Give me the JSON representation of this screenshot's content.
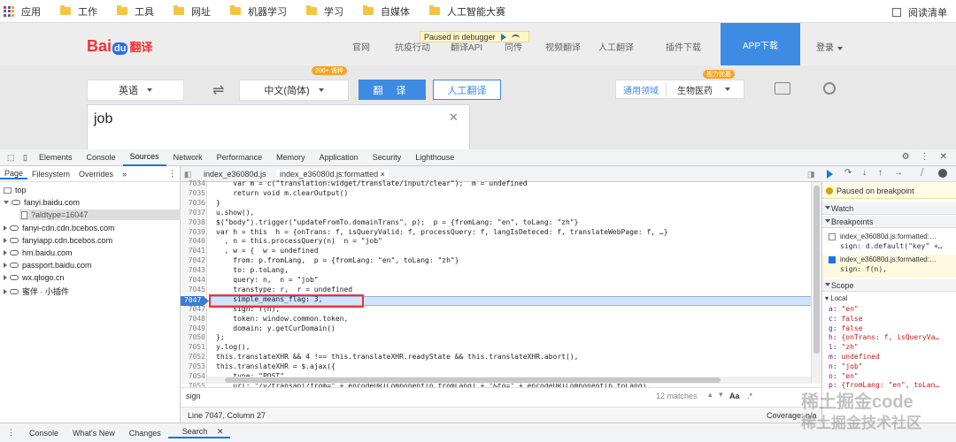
{
  "bookmarks": {
    "items": [
      "应用",
      "工作",
      "工具",
      "网址",
      "机器学习",
      "学习",
      "自媒体",
      "人工智能大赛"
    ],
    "reading_list": "阅读清单"
  },
  "baidu": {
    "logo_text": "Bai",
    "logo_du": "du",
    "logo_suffix": "翻译",
    "nav": [
      "官网",
      "抗疫行动",
      "翻译API",
      "同传",
      "视频翻译",
      "人工翻译",
      "插件下载"
    ],
    "app_download": "APP下载",
    "login": "登录",
    "debugger_pill": "Paused in debugger",
    "badge_200": "200+ 语种",
    "source_lang": "英语",
    "target_lang": "中文(简体)",
    "translate_btn": "翻 译",
    "human_btn": "人工翻译",
    "domain_label": "通用领域",
    "domain_value": "生物医药",
    "vip_badge": "视力优惠",
    "input_text": "job",
    "clear_icon": "✕"
  },
  "devtools": {
    "tabs": [
      "Elements",
      "Console",
      "Sources",
      "Network",
      "Performance",
      "Memory",
      "Application",
      "Security",
      "Lighthouse"
    ],
    "active_tab": "Sources",
    "nav_tabs": [
      "Page",
      "Filesystem",
      "Overrides",
      "»"
    ],
    "tree": [
      "top",
      "fanyi.baidu.com",
      "?aldtype=16047",
      "fanyi-cdn.cdn.bcebos.com",
      "fanyiapp.cdn.bcebos.com",
      "hm.baidu.com",
      "passport.baidu.com",
      "wx.qlogo.cn",
      "蜜伴 · 小插件"
    ],
    "editor_tabs": [
      "index_e36080d.js",
      "index_e36080d.js:formatted"
    ],
    "close_x": "×",
    "lines": [
      {
        "n": "7034",
        "code": "    var m = c(\"translation:widget/translate/input/clear\");  m = undefined"
      },
      {
        "n": "7035",
        "code": "    return void m.clearOutput()"
      },
      {
        "n": "7036",
        "code": "}"
      },
      {
        "n": "7037",
        "code": "u.show(),"
      },
      {
        "n": "7038",
        "code": "$(\"body\").trigger(\"updateFromTo.domainTrans\", p);  p = {fromLang: \"en\", toLang: \"zh\"}"
      },
      {
        "n": "7039",
        "code": "var h = this  h = {onTrans: f, isQueryValid: f, processQuery: f, langIsDeteced: f, translateWebPage: f, …}"
      },
      {
        "n": "7040",
        "code": "  , n = this.processQuery(n)  n = \"job\""
      },
      {
        "n": "7041",
        "code": "  , w = {  w = undefined"
      },
      {
        "n": "7042",
        "code": "    from: p.fromLang,  p = {fromLang: \"en\", toLang: \"zh\"}"
      },
      {
        "n": "7043",
        "code": "    to: p.toLang,"
      },
      {
        "n": "7044",
        "code": "    query: n,  n = \"job\""
      },
      {
        "n": "7045",
        "code": "    transtype: r,  r = undefined"
      },
      {
        "n": "7046",
        "code": "    simple_means_flag: 3,"
      },
      {
        "n": "7047",
        "code": "    sign: f(n),"
      },
      {
        "n": "7048",
        "code": "    token: window.common.token,"
      },
      {
        "n": "7049",
        "code": "    domain: y.getCurDomain()"
      },
      {
        "n": "7050",
        "code": "};"
      },
      {
        "n": "7051",
        "code": "y.log(),"
      },
      {
        "n": "7052",
        "code": "this.translateXHR && 4 !== this.translateXHR.readyState && this.translateXHR.abort(),"
      },
      {
        "n": "7053",
        "code": "this.translateXHR = $.ajax({"
      },
      {
        "n": "7054",
        "code": "    type: \"POST\","
      },
      {
        "n": "7055",
        "code": "    url: \"/v2transapi?from=\" + encodeURIComponent(p.fromLang) + \"&to=\" + encodeURIComponent(p.toLang),"
      },
      {
        "n": "7056",
        "code": "    data: w,"
      }
    ],
    "search_text": "sign",
    "search_matches": "12 matches",
    "search_aa": "Aa",
    "search_regex": ".*",
    "status_text": "Line 7047, Column 27",
    "status_coverage": "Coverage: n/a",
    "paused_banner": "Paused on breakpoint",
    "watch_label": "Watch",
    "breakpoints_label": "Breakpoints",
    "breakpoints": [
      {
        "file": "index_e36080d.js:formatted:…",
        "code": "sign: d.default(\"key\" +…",
        "checked": false
      },
      {
        "file": "index_e36080d.js:formatted:…",
        "code": "sign: f(n),",
        "checked": true
      }
    ],
    "scope_label": "Scope",
    "local_label": "Local",
    "scope_vars": [
      {
        "k": "a",
        "v": "\"en\""
      },
      {
        "k": "c",
        "v": "false"
      },
      {
        "k": "g",
        "v": "false"
      },
      {
        "k": "h",
        "v": "{onTrans: f, isQueryVa…"
      },
      {
        "k": "l",
        "v": "\"zh\""
      },
      {
        "k": "m",
        "v": "undefined"
      },
      {
        "k": "n",
        "v": "\"job\""
      },
      {
        "k": "o",
        "v": "\"en\""
      },
      {
        "k": "p",
        "v": "{fromLang: \"en\", toLan…"
      }
    ],
    "drawer_tabs": [
      "Console",
      "What's New",
      "Changes",
      "Search"
    ],
    "drawer_active": "Search"
  },
  "watermark": {
    "line1": "稀土掘金code",
    "line2": "稀土掘金技术社区"
  },
  "colors": {
    "accent": "#1a73e8",
    "baidu_blue": "#3d8be3",
    "exec_line": "#d2e3fc",
    "breakpoint": "#3b7bd8",
    "highlight_box": "#e33333"
  }
}
